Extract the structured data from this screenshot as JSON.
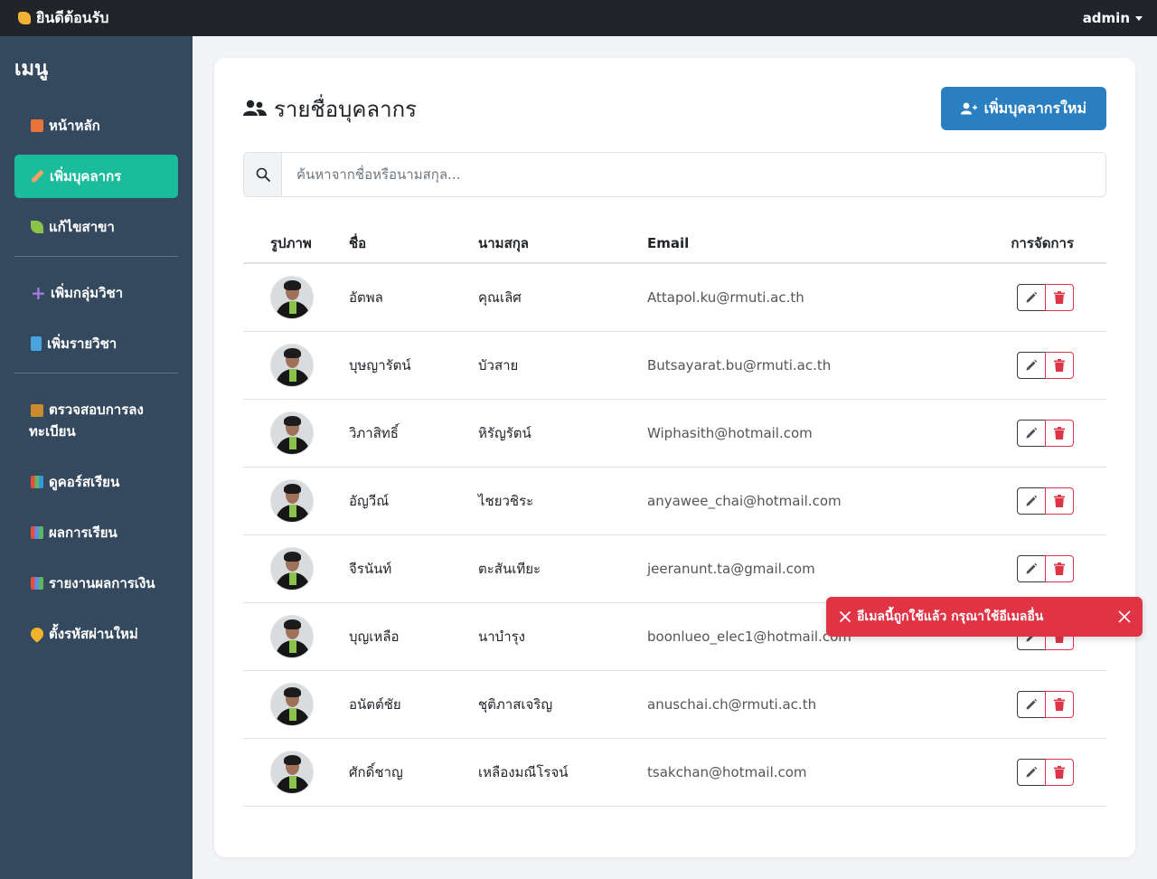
{
  "topbar": {
    "brand": "ยินดีต้อนรับ",
    "user": "admin"
  },
  "sidebar": {
    "title": "เมนู",
    "items": [
      {
        "label": "หน้าหลัก",
        "icon": "house-icon",
        "color": "#e8743b"
      },
      {
        "label": "เพิ่มบุคลากร",
        "icon": "pencil-icon",
        "color": "#f4a261",
        "active": true
      },
      {
        "label": "แก้ไขสาขา",
        "icon": "seedling-icon",
        "color": "#8bc34a"
      },
      {
        "label": "เพิ่มกลุ่มวิชา",
        "icon": "plus-icon",
        "color": "#a57be6"
      },
      {
        "label": "เพิ่มรายวิชา",
        "icon": "book-icon",
        "color": "#4aa3df"
      },
      {
        "label": "ตรวจสอบการลงทะเบียน",
        "icon": "inspector-icon",
        "color": "#c98b2b"
      },
      {
        "label": "ดูคอร์สเรียน",
        "icon": "books-icon",
        "color": "#5cb85c"
      },
      {
        "label": "ผลการเรียน",
        "icon": "chart-icon",
        "color": "#5b8def"
      },
      {
        "label": "รายงานผลการเงิน",
        "icon": "chart-icon",
        "color": "#5b8def"
      },
      {
        "label": "ตั้งรหัสผ่านใหม่",
        "icon": "key-icon",
        "color": "#f0b429"
      }
    ]
  },
  "main": {
    "title": "รายชื่อบุคลากร",
    "add_button": "เพิ่มบุคลากรใหม่",
    "search_placeholder": "ค้นหาจากชื่อหรือนามสกุล...",
    "columns": {
      "photo": "รูปภาพ",
      "first_name": "ชื่อ",
      "last_name": "นามสกุล",
      "email": "Email",
      "actions": "การจัดการ"
    },
    "rows": [
      {
        "first": "อัตพล",
        "last": "คุณเลิศ",
        "email": "Attapol.ku@rmuti.ac.th"
      },
      {
        "first": "บุษญารัตน์",
        "last": "บัวสาย",
        "email": "Butsayarat.bu@rmuti.ac.th"
      },
      {
        "first": "วิภาสิทธิ์",
        "last": "หิรัญรัตน์",
        "email": "Wiphasith@hotmail.com"
      },
      {
        "first": "อัญวีณ์",
        "last": "ไชยวชิระ",
        "email": "anyawee_chai@hotmail.com"
      },
      {
        "first": "จีรนันท์",
        "last": "ตะสันเทียะ",
        "email": "jeeranunt.ta@gmail.com"
      },
      {
        "first": "บุญเหลือ",
        "last": "นาบำรุง",
        "email": "boonlueo_elec1@hotmail.com"
      },
      {
        "first": "อนัตต์ชัย",
        "last": "ชุติภาสเจริญ",
        "email": "anuschai.ch@rmuti.ac.th"
      },
      {
        "first": "ศักดิ์ชาญ",
        "last": "เหลืองมณีโรจน์",
        "email": "tsakchan@hotmail.com"
      }
    ]
  },
  "toast": {
    "message": "อีเมลนี้ถูกใช้แล้ว กรุณาใช้อีเมลอื่น"
  }
}
